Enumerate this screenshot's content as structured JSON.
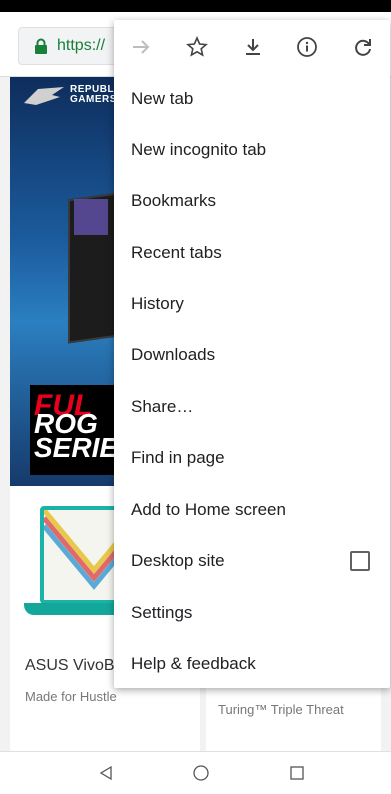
{
  "browser": {
    "url": "https://",
    "colors": {
      "lock": "#188038",
      "url": "#188038"
    }
  },
  "banner": {
    "brand_line1": "REPUBLIC",
    "brand_line2": "GAMERS",
    "promo_line1": "FUL",
    "promo_line2": "ROG",
    "promo_line3": "SERIE"
  },
  "cards": [
    {
      "title": "ASUS VivoB",
      "subtitle": "Made for Hustle"
    },
    {
      "title": "",
      "subtitle": "Turing™ Triple Threat"
    }
  ],
  "menu": {
    "icons": [
      "forward-icon",
      "star-icon",
      "download-icon",
      "info-icon",
      "refresh-icon"
    ],
    "items": [
      {
        "label": "New tab"
      },
      {
        "label": "New incognito tab"
      },
      {
        "label": "Bookmarks"
      },
      {
        "label": "Recent tabs"
      },
      {
        "label": "History"
      },
      {
        "label": "Downloads"
      },
      {
        "label": "Share…"
      },
      {
        "label": "Find in page"
      },
      {
        "label": "Add to Home screen"
      },
      {
        "label": "Desktop site",
        "checked": false
      },
      {
        "label": "Settings"
      },
      {
        "label": "Help & feedback"
      }
    ]
  },
  "navbar": {
    "icons": [
      "back-triangle-icon",
      "home-circle-icon",
      "recents-square-icon"
    ]
  }
}
